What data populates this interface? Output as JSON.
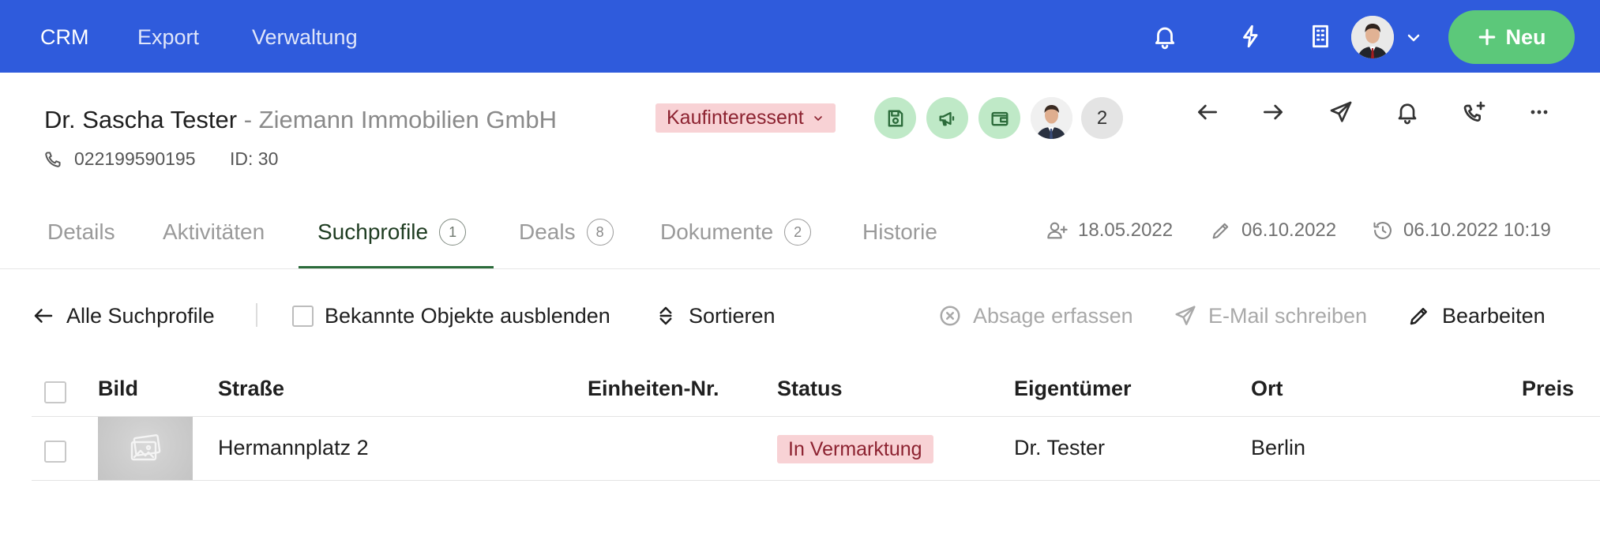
{
  "topnav": {
    "items": [
      {
        "label": "CRM"
      },
      {
        "label": "Export"
      },
      {
        "label": "Verwaltung"
      }
    ],
    "icons": [
      "bell-icon",
      "lightning-icon",
      "building-icon"
    ],
    "new_button_label": "Neu",
    "accent_color": "#2f5bdc",
    "new_button_color": "#5cc87a"
  },
  "contact": {
    "name": "Dr. Sascha Tester",
    "separator": " - ",
    "company": "Ziemann Immobilien GmbH",
    "phone": "022199590195",
    "id": "ID: 30",
    "lead_status": "Kaufinteressent",
    "linked_count": "2"
  },
  "tabs": [
    {
      "label": "Details"
    },
    {
      "label": "Aktivitäten"
    },
    {
      "label": "Suchprofile",
      "count": "1",
      "active": true
    },
    {
      "label": "Deals",
      "count": "8"
    },
    {
      "label": "Dokumente",
      "count": "2"
    },
    {
      "label": "Historie"
    }
  ],
  "meta": {
    "created": "18.05.2022",
    "edited": "06.10.2022",
    "last_activity": "06.10.2022 10:19"
  },
  "toolbar": {
    "back_label": "Alle Suchprofile",
    "hide_known_label": "Bekannte Objekte ausblenden",
    "sort_label": "Sortieren",
    "decline_label": "Absage erfassen",
    "email_label": "E-Mail schreiben",
    "edit_label": "Bearbeiten"
  },
  "table": {
    "columns": [
      "Bild",
      "Straße",
      "Einheiten-Nr.",
      "Status",
      "Eigentümer",
      "Ort",
      "Preis"
    ],
    "rows": [
      {
        "street": "Hermannplatz 2",
        "unit": "",
        "status": "In Vermarktung",
        "owner": "Dr. Tester",
        "city": "Berlin",
        "price": ""
      }
    ]
  },
  "colors": {
    "status_badge_bg": "#f8d2d5",
    "status_badge_text": "#8c2230",
    "active_tab": "#2b6b3a",
    "quick_action_bg": "#bfe9c7"
  }
}
